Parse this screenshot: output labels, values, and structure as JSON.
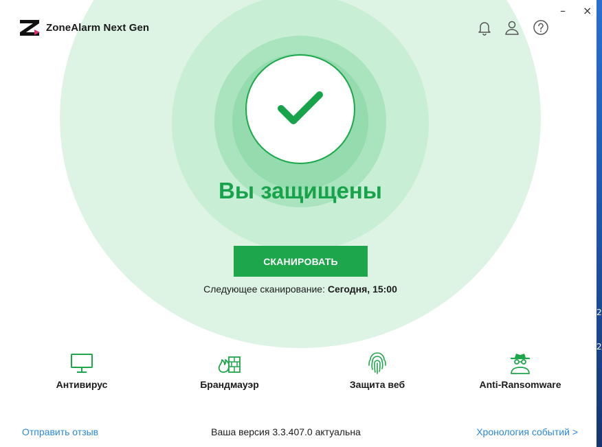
{
  "app": {
    "title": "ZoneAlarm Next Gen"
  },
  "window_controls": {
    "minimize": "–",
    "close": "×"
  },
  "header_icons": [
    "bell-icon",
    "user-icon",
    "help-icon"
  ],
  "status": {
    "title": "Вы защищены",
    "icon": "checkmark-icon"
  },
  "scan": {
    "button_label": "СКАНИРОВАТЬ",
    "next_scan_label": "Следующее сканирование: ",
    "next_scan_value": "Сегодня, 15:00"
  },
  "features": [
    {
      "label": "Антивирус",
      "icon": "monitor-icon"
    },
    {
      "label": "Брандмауэр",
      "icon": "firewall-icon"
    },
    {
      "label": "Защита веб",
      "icon": "fingerprint-icon"
    },
    {
      "label": "Anti-Ransomware",
      "icon": "spy-icon"
    }
  ],
  "footer": {
    "feedback_link": "Отправить отзыв",
    "version_text": "Ваша версия 3.3.407.0 актуальна",
    "timeline_link": "Хронология событий >"
  },
  "desktop_edge": {
    "glyph_1": "2",
    "glyph_2": "2"
  },
  "colors": {
    "accent_green": "#1ea64b",
    "status_green": "#17a34a",
    "link_blue": "#2b88d8"
  }
}
